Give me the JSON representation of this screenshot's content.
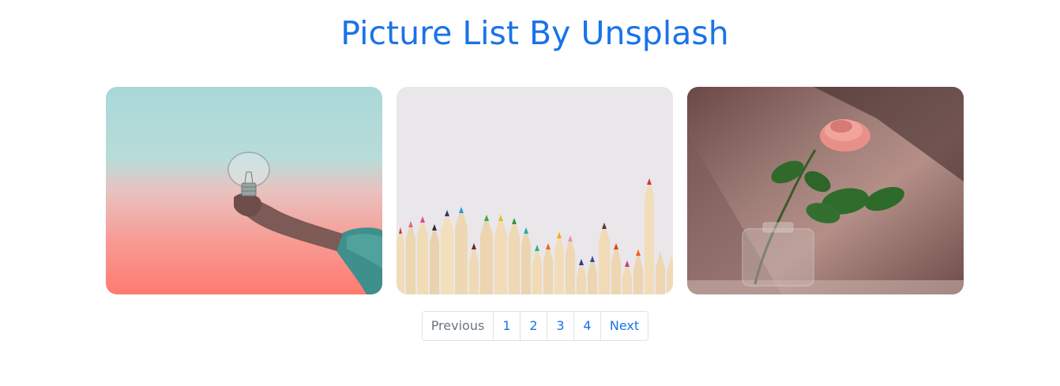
{
  "header": {
    "title": "Picture List By Unsplash"
  },
  "gallery": {
    "images": [
      {
        "alt": "Hand holding a light bulb against a pastel sky"
      },
      {
        "alt": "Row of colored pencils on white background"
      },
      {
        "alt": "Pink rose in a glass vase"
      }
    ]
  },
  "pagination": {
    "previous_label": "Previous",
    "pages": [
      "1",
      "2",
      "3",
      "4"
    ],
    "next_label": "Next",
    "previous_disabled": true
  },
  "colors": {
    "accent": "#1a73e8",
    "border": "#dee2e6",
    "disabled_text": "#6c757d"
  }
}
